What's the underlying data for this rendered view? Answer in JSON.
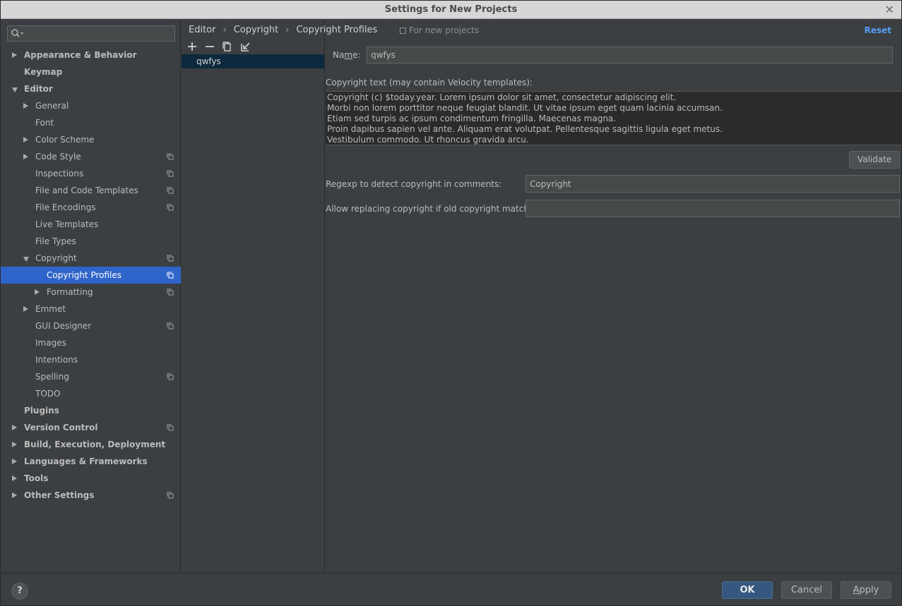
{
  "window": {
    "title": "Settings for New Projects",
    "close_glyph": "✕"
  },
  "search": {
    "placeholder": "",
    "value": ""
  },
  "tree": [
    {
      "label": "Appearance & Behavior",
      "level": 0,
      "bold": true,
      "arrow": "right",
      "proj": false,
      "selected": false
    },
    {
      "label": "Keymap",
      "level": 0,
      "bold": true,
      "arrow": "",
      "proj": false,
      "selected": false
    },
    {
      "label": "Editor",
      "level": 0,
      "bold": true,
      "arrow": "down",
      "proj": false,
      "selected": false
    },
    {
      "label": "General",
      "level": 1,
      "bold": false,
      "arrow": "right",
      "proj": false,
      "selected": false
    },
    {
      "label": "Font",
      "level": 1,
      "bold": false,
      "arrow": "",
      "proj": false,
      "selected": false
    },
    {
      "label": "Color Scheme",
      "level": 1,
      "bold": false,
      "arrow": "right",
      "proj": false,
      "selected": false
    },
    {
      "label": "Code Style",
      "level": 1,
      "bold": false,
      "arrow": "right",
      "proj": true,
      "selected": false
    },
    {
      "label": "Inspections",
      "level": 1,
      "bold": false,
      "arrow": "",
      "proj": true,
      "selected": false
    },
    {
      "label": "File and Code Templates",
      "level": 1,
      "bold": false,
      "arrow": "",
      "proj": true,
      "selected": false
    },
    {
      "label": "File Encodings",
      "level": 1,
      "bold": false,
      "arrow": "",
      "proj": true,
      "selected": false
    },
    {
      "label": "Live Templates",
      "level": 1,
      "bold": false,
      "arrow": "",
      "proj": false,
      "selected": false
    },
    {
      "label": "File Types",
      "level": 1,
      "bold": false,
      "arrow": "",
      "proj": false,
      "selected": false
    },
    {
      "label": "Copyright",
      "level": 1,
      "bold": false,
      "arrow": "down",
      "proj": true,
      "selected": false
    },
    {
      "label": "Copyright Profiles",
      "level": 2,
      "bold": false,
      "arrow": "",
      "proj": true,
      "selected": true
    },
    {
      "label": "Formatting",
      "level": 2,
      "bold": false,
      "arrow": "right",
      "proj": true,
      "selected": false
    },
    {
      "label": "Emmet",
      "level": 1,
      "bold": false,
      "arrow": "right",
      "proj": false,
      "selected": false
    },
    {
      "label": "GUI Designer",
      "level": 1,
      "bold": false,
      "arrow": "",
      "proj": true,
      "selected": false
    },
    {
      "label": "Images",
      "level": 1,
      "bold": false,
      "arrow": "",
      "proj": false,
      "selected": false
    },
    {
      "label": "Intentions",
      "level": 1,
      "bold": false,
      "arrow": "",
      "proj": false,
      "selected": false
    },
    {
      "label": "Spelling",
      "level": 1,
      "bold": false,
      "arrow": "",
      "proj": true,
      "selected": false
    },
    {
      "label": "TODO",
      "level": 1,
      "bold": false,
      "arrow": "",
      "proj": false,
      "selected": false
    },
    {
      "label": "Plugins",
      "level": 0,
      "bold": true,
      "arrow": "",
      "proj": false,
      "selected": false
    },
    {
      "label": "Version Control",
      "level": 0,
      "bold": true,
      "arrow": "right",
      "proj": true,
      "selected": false
    },
    {
      "label": "Build, Execution, Deployment",
      "level": 0,
      "bold": true,
      "arrow": "right",
      "proj": false,
      "selected": false
    },
    {
      "label": "Languages & Frameworks",
      "level": 0,
      "bold": true,
      "arrow": "right",
      "proj": false,
      "selected": false
    },
    {
      "label": "Tools",
      "level": 0,
      "bold": true,
      "arrow": "right",
      "proj": false,
      "selected": false
    },
    {
      "label": "Other Settings",
      "level": 0,
      "bold": true,
      "arrow": "right",
      "proj": true,
      "selected": false
    }
  ],
  "breadcrumb": {
    "items": [
      "Editor",
      "Copyright",
      "Copyright Profiles"
    ],
    "separator": "›",
    "scope": "For new projects",
    "reset": "Reset"
  },
  "profiles": {
    "items": [
      "qwfys"
    ]
  },
  "form": {
    "name_label_pre": "Na",
    "name_label_mn": "m",
    "name_label_post": "e:",
    "name_value": "qwfys",
    "copyright_text_label": "Copyright text (may contain Velocity templates):",
    "copyright_text": "Copyright (c) $today.year. Lorem ipsum dolor sit amet, consectetur adipiscing elit.\nMorbi non lorem porttitor neque feugiat blandit. Ut vitae ipsum eget quam lacinia accumsan.\nEtiam sed turpis ac ipsum condimentum fringilla. Maecenas magna.\nProin dapibus sapien vel ante. Aliquam erat volutpat. Pellentesque sagittis ligula eget metus.\nVestibulum commodo. Ut rhoncus gravida arcu. ",
    "validate": "Validate",
    "regexp_label": "Regexp to detect copyright in comments:",
    "regexp_value": "Copyright",
    "replace_label": "Allow replacing copyright if old copyright matches:",
    "replace_value": ""
  },
  "footer": {
    "help": "?",
    "ok": "OK",
    "cancel": "Cancel",
    "apply_u": "A",
    "apply_rest": "pply"
  },
  "colors": {
    "selection": "#2f65ca",
    "link": "#589df6",
    "ok_button": "#365880",
    "profile_selection": "#0d293e"
  }
}
